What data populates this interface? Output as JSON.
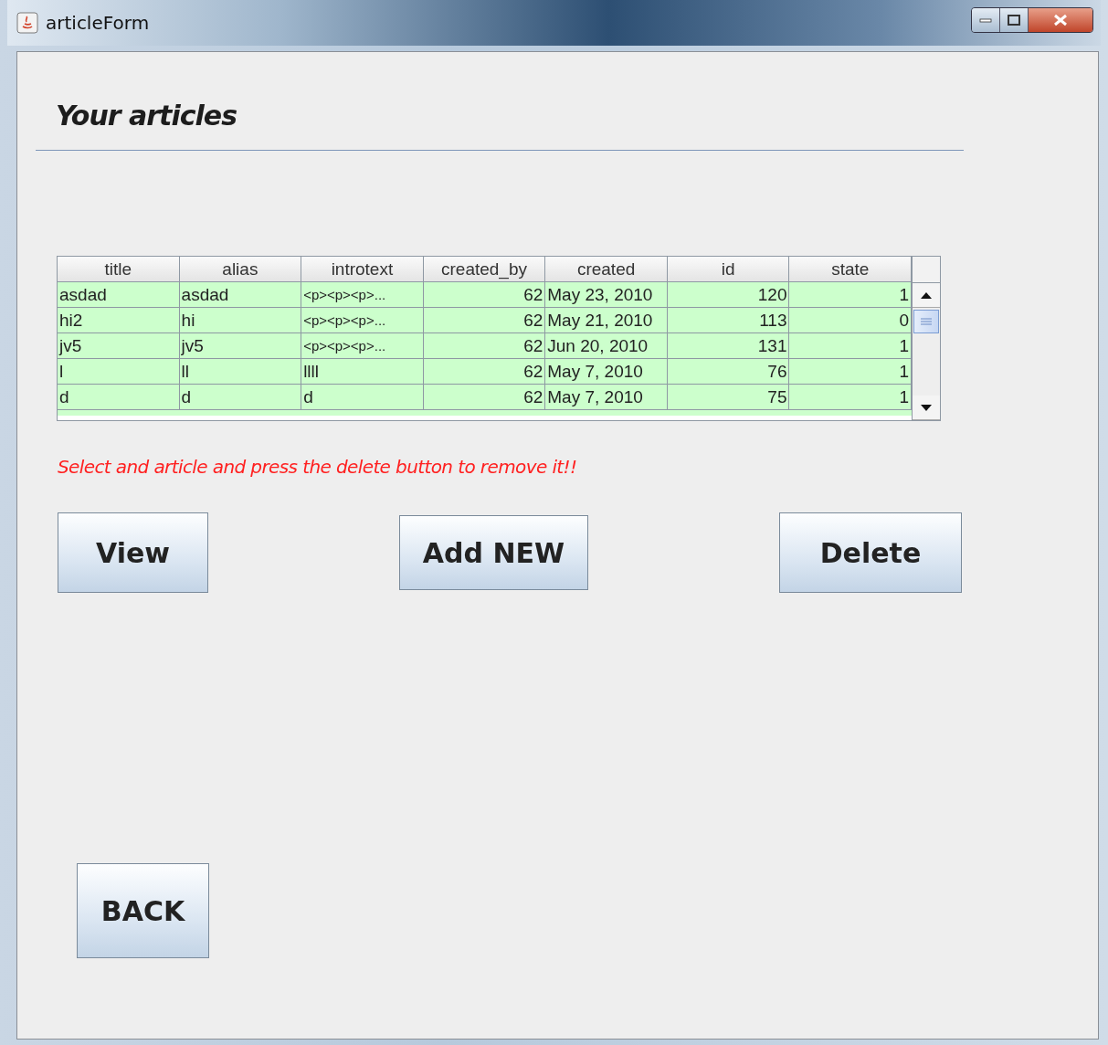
{
  "window": {
    "title": "articleForm"
  },
  "heading": "Your articles",
  "table": {
    "columns": [
      {
        "label": "title",
        "kind": "text"
      },
      {
        "label": "alias",
        "kind": "text"
      },
      {
        "label": "introtext",
        "kind": "text"
      },
      {
        "label": "created_by",
        "kind": "number"
      },
      {
        "label": "created",
        "kind": "text"
      },
      {
        "label": "id",
        "kind": "number"
      },
      {
        "label": "state",
        "kind": "number"
      }
    ],
    "rows": [
      [
        "asdad",
        "asdad",
        "<p><p><p>...",
        "62",
        "May 23, 2010",
        "120",
        "1"
      ],
      [
        "hi2",
        "hi",
        "<p><p><p>...",
        "62",
        "May 21, 2010",
        "113",
        "0"
      ],
      [
        "jv5",
        "jv5",
        "<p><p><p>...",
        "62",
        "Jun 20, 2010",
        "131",
        "1"
      ],
      [
        "l",
        "ll",
        "llll",
        "62",
        "May 7, 2010",
        "76",
        "1"
      ],
      [
        "d",
        "d",
        "d",
        "62",
        "May 7, 2010",
        "75",
        "1"
      ]
    ]
  },
  "hint": "Select and article and press the delete button to remove it!!",
  "buttons": [
    "View",
    "Add NEW",
    "Delete"
  ],
  "back_button": "BACK"
}
